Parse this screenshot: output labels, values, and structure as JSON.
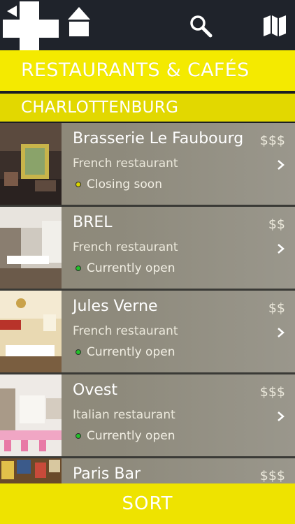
{
  "header": {
    "icons": [
      "back-icon",
      "add-icon",
      "home-icon",
      "search-icon",
      "map-icon"
    ]
  },
  "title": "RESTAURANTS & CAFÉS",
  "district": "CHARLOTTENBURG",
  "restaurants": [
    {
      "name": "Brasserie Le Faubourg",
      "price": "$$$",
      "type": "French restaurant",
      "status": "Closing soon",
      "status_color": "#d9d400"
    },
    {
      "name": "BREL",
      "price": "$$",
      "type": "French restaurant",
      "status": "Currently open",
      "status_color": "#22c02a"
    },
    {
      "name": "Jules Verne",
      "price": "$$",
      "type": "French restaurant",
      "status": "Currently open",
      "status_color": "#22c02a"
    },
    {
      "name": "Ovest",
      "price": "$$$",
      "type": "Italian restaurant",
      "status": "Currently open",
      "status_color": "#22c02a"
    },
    {
      "name": "Paris Bar",
      "price": "$$$",
      "type": "",
      "status": "",
      "status_color": ""
    }
  ],
  "sort_label": "SORT",
  "colors": {
    "accent_yellow": "#f4ea00",
    "topbar": "#1f232b",
    "open_green": "#22c02a",
    "closing_yellow": "#d9d400"
  }
}
